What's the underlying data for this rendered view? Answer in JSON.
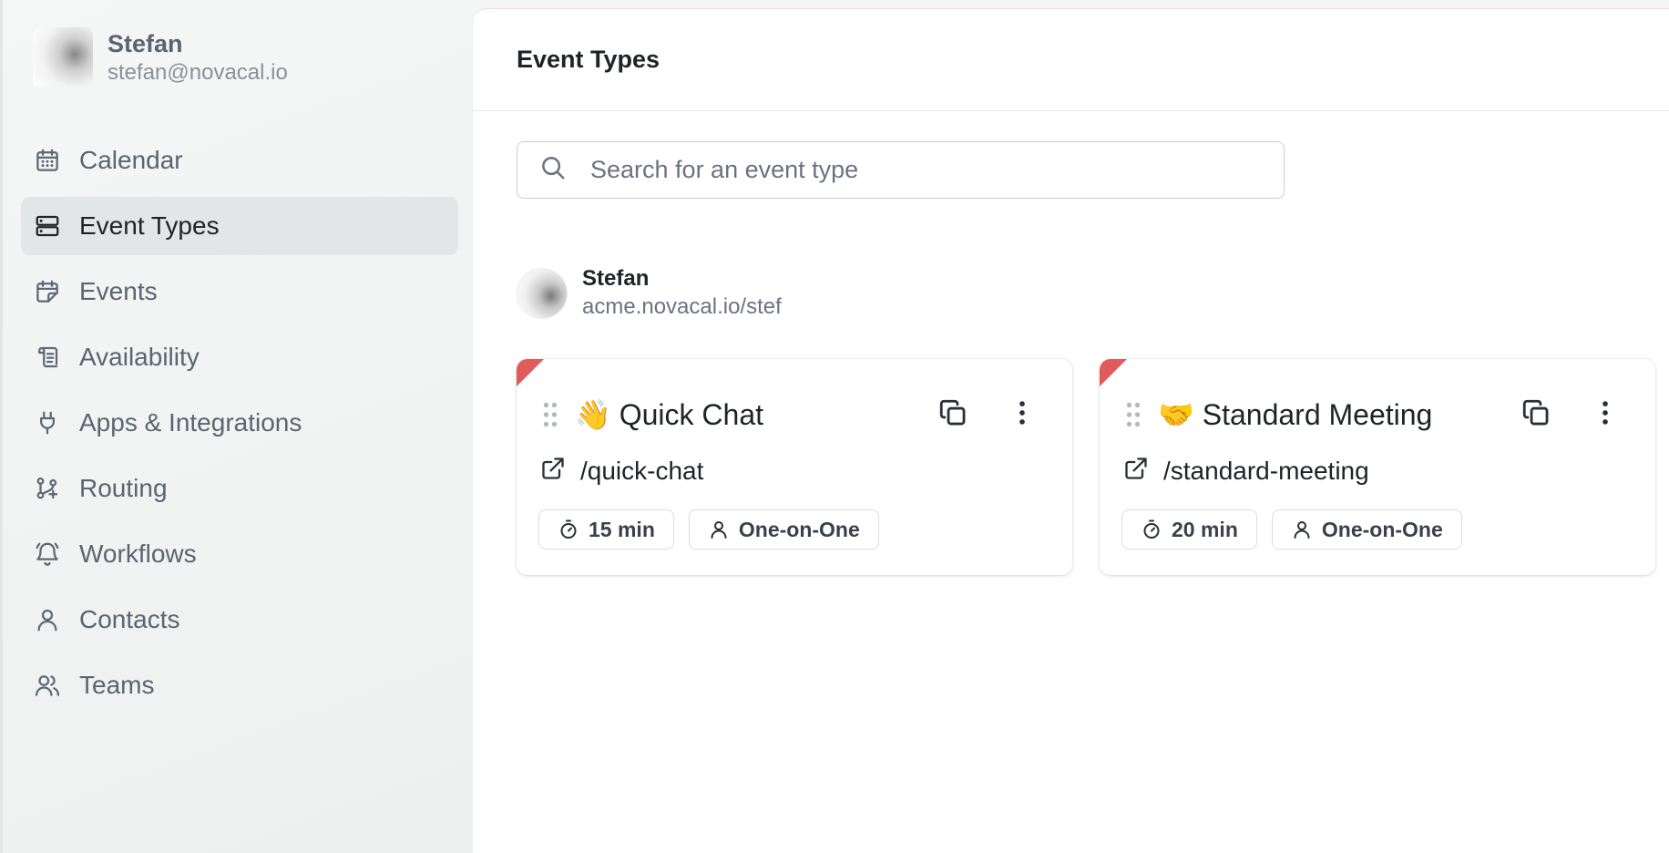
{
  "user": {
    "name": "Stefan",
    "email": "stefan@novacal.io"
  },
  "nav": [
    {
      "label": "Calendar",
      "icon": "calendar-icon"
    },
    {
      "label": "Event Types",
      "icon": "event-types-icon",
      "active": true
    },
    {
      "label": "Events",
      "icon": "events-icon"
    },
    {
      "label": "Availability",
      "icon": "availability-icon"
    },
    {
      "label": "Apps & Integrations",
      "icon": "plug-icon"
    },
    {
      "label": "Routing",
      "icon": "routing-icon"
    },
    {
      "label": "Workflows",
      "icon": "bell-icon"
    },
    {
      "label": "Contacts",
      "icon": "user-icon"
    },
    {
      "label": "Teams",
      "icon": "users-icon"
    }
  ],
  "header": {
    "title": "Event Types"
  },
  "search": {
    "placeholder": "Search for an event type",
    "value": ""
  },
  "owner": {
    "name": "Stefan",
    "url": "acme.novacal.io/stef"
  },
  "event_types": [
    {
      "emoji": "👋",
      "title": "Quick Chat",
      "slug": "/quick-chat",
      "duration": "15 min",
      "kind": "One-on-One"
    },
    {
      "emoji": "🤝",
      "title": "Standard Meeting",
      "slug": "/standard-meeting",
      "duration": "20 min",
      "kind": "One-on-One"
    }
  ],
  "colors": {
    "accent_corner": "#e15b5b",
    "active_nav_bg": "#e3e6e6"
  }
}
